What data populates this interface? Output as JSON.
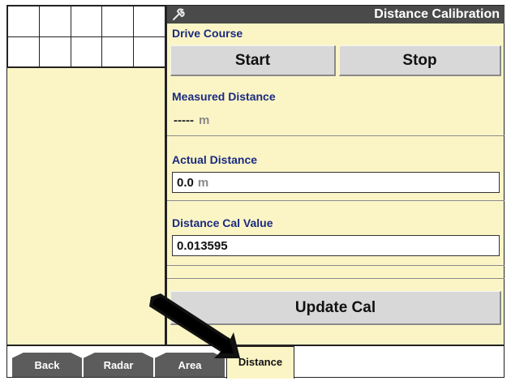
{
  "window": {
    "title": "Distance Calibration"
  },
  "drive_course": {
    "label": "Drive Course",
    "start_label": "Start",
    "stop_label": "Stop"
  },
  "measured": {
    "label": "Measured Distance",
    "value": "-----",
    "unit": "m"
  },
  "actual": {
    "label": "Actual Distance",
    "value": "0.0",
    "unit": "m"
  },
  "cal": {
    "label": "Distance Cal Value",
    "value": "0.013595"
  },
  "update_label": "Update Cal",
  "tabs": {
    "back": "Back",
    "radar": "Radar",
    "area": "Area",
    "distance": "Distance"
  },
  "icons": {
    "wrench": "wrench-icon",
    "pointer": "pointer-arrow-icon"
  },
  "colors": {
    "panel": "#fbf5c6",
    "label": "#1a2a80",
    "titlebar": "#4a4a4a",
    "tab": "#5c5c5c"
  }
}
